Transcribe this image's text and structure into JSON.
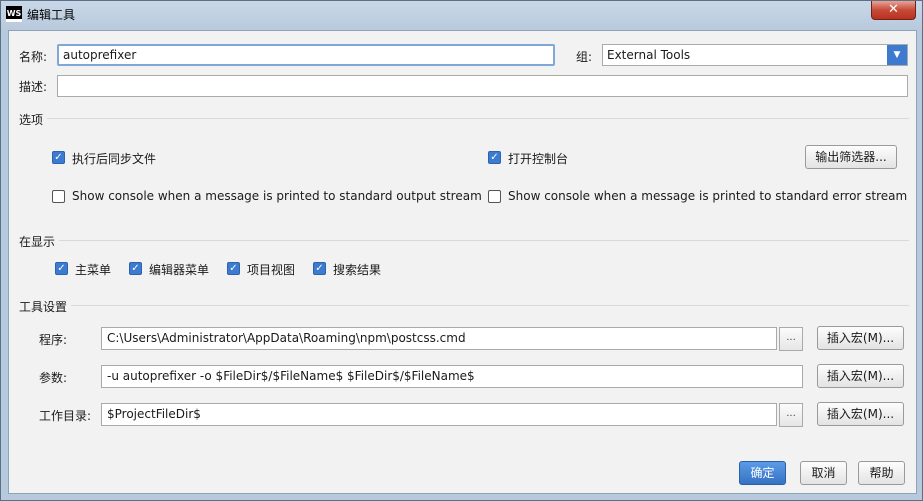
{
  "window": {
    "icon": "WS",
    "title": "编辑工具",
    "close_icon": "✕"
  },
  "name": {
    "label": "名称:",
    "value": "autoprefixer"
  },
  "group": {
    "label": "组:",
    "value": "External Tools",
    "arrow": "▼"
  },
  "description": {
    "label": "描述:",
    "value": ""
  },
  "options": {
    "title": "选项",
    "sync_after": {
      "label": "执行后同步文件",
      "checked": true
    },
    "open_console": {
      "label": "打开控制台",
      "checked": true
    },
    "output_filters_button": "输出筛选器...",
    "show_console_stdout": {
      "label": "Show console when a message is printed to standard output stream",
      "checked": false
    },
    "show_console_stderr": {
      "label": "Show console when a message is printed to standard error stream",
      "checked": false
    }
  },
  "show_in": {
    "title": "在显示",
    "items": [
      {
        "label": "主菜单",
        "checked": true
      },
      {
        "label": "编辑器菜单",
        "checked": true
      },
      {
        "label": "项目视图",
        "checked": true
      },
      {
        "label": "搜索结果",
        "checked": true
      }
    ]
  },
  "tool_settings": {
    "title": "工具设置",
    "program": {
      "label": "程序:",
      "value": "C:\\Users\\Administrator\\AppData\\Roaming\\npm\\postcss.cmd"
    },
    "parameters": {
      "label": "参数:",
      "value": "-u autoprefixer -o $FileDir$/$FileName$  $FileDir$/$FileName$"
    },
    "working_dir": {
      "label": "工作目录:",
      "value": "$ProjectFileDir$"
    },
    "browse_label": "...",
    "insert_macro_label": "插入宏(M)..."
  },
  "footer": {
    "ok": "确定",
    "cancel": "取消",
    "help": "帮助"
  },
  "check_glyph": "✓",
  "colors": {
    "accent": "#3d7bd1",
    "close": "#c74a38"
  }
}
